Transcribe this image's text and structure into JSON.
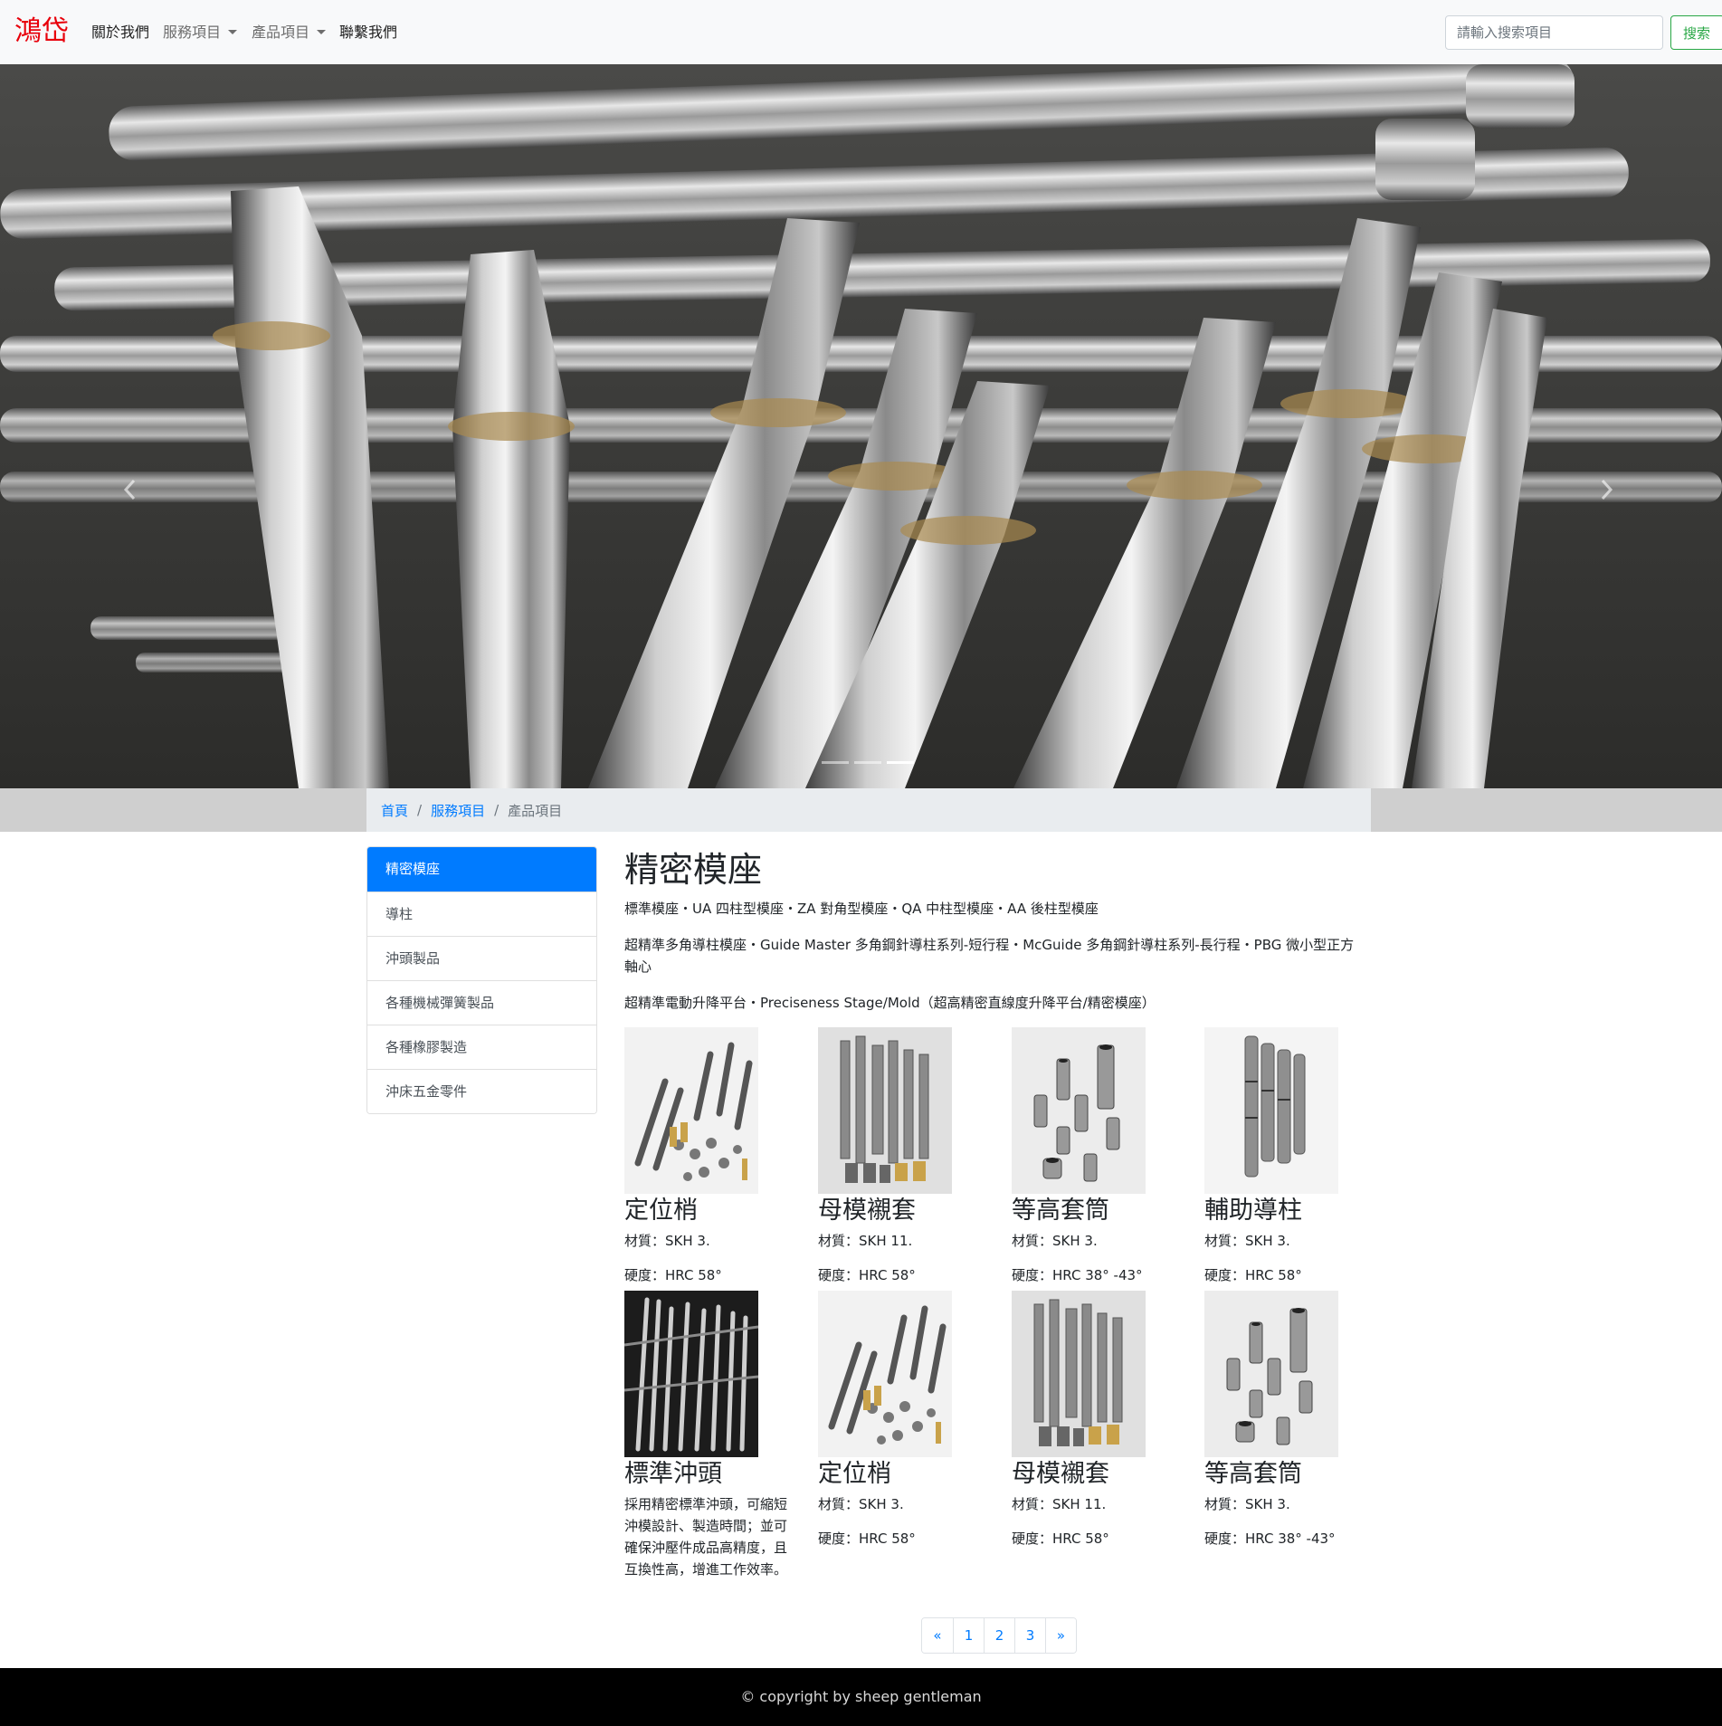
{
  "navbar": {
    "brand": "鴻岱",
    "links": [
      {
        "label": "關於我們"
      },
      {
        "label": "服務項目"
      },
      {
        "label": "產品項目"
      },
      {
        "label": "聯繫我們"
      }
    ],
    "search": {
      "placeholder": "請輸入搜索項目",
      "button_label": "搜索"
    }
  },
  "carousel": {
    "slide_count": 3,
    "active_index": 2,
    "icons": [
      "chevron-left-icon",
      "chevron-right-icon"
    ]
  },
  "breadcrumb": {
    "items": [
      "首頁",
      "服務項目",
      "產品項目"
    ],
    "separator": "/"
  },
  "sidebar": {
    "items": [
      {
        "label": "精密模座",
        "active": true
      },
      {
        "label": "導柱"
      },
      {
        "label": "沖頭製品"
      },
      {
        "label": "各種機械彈簧製品"
      },
      {
        "label": "各種橡膠製造"
      },
      {
        "label": "沖床五金零件"
      }
    ]
  },
  "main": {
    "title": "精密模座",
    "paragraphs": [
      "標準模座・UA 四柱型模座・ZA 對角型模座・QA 中柱型模座・AA 後柱型模座",
      "超精準多角導柱模座・Guide Master 多角鋼針導柱系列-短行程・McGuide 多角鋼針導柱系列-長行程・PBG 微小型正方軸心",
      "超精準電動升降平台・Preciseness Stage/Mold（超高精密直線度升降平台/精密模座）"
    ],
    "products": [
      {
        "name": "定位梢",
        "material": "材質：SKH 3.",
        "hardness": "硬度：HRC 58°"
      },
      {
        "name": "母模襯套",
        "material": "材質：SKH 11.",
        "hardness": "硬度：HRC 58°"
      },
      {
        "name": "等高套筒",
        "material": "材質：SKH 3.",
        "hardness": "硬度：HRC 38° -43°"
      },
      {
        "name": "輔助導柱",
        "material": "材質：SKH 3.",
        "hardness": "硬度：HRC 58°"
      },
      {
        "name": "標準沖頭",
        "description": "採用精密標準沖頭，可縮短沖模設計、製造時間；並可確保沖壓件成品高精度，且互換性高，增進工作效率。"
      },
      {
        "name": "定位梢",
        "material": "材質：SKH 3.",
        "hardness": "硬度：HRC 58°"
      },
      {
        "name": "母模襯套",
        "material": "材質：SKH 11.",
        "hardness": "硬度：HRC 58°"
      },
      {
        "name": "等高套筒",
        "material": "材質：SKH 3.",
        "hardness": "硬度：HRC 38° -43°"
      }
    ]
  },
  "pagination": {
    "prev": "«",
    "pages": [
      "1",
      "2",
      "3"
    ],
    "next": "»"
  },
  "footer": {
    "text": "© copyright by sheep gentleman"
  },
  "colors": {
    "brand": "#e8000b",
    "link": "#007bff",
    "success": "#28a745",
    "footer_bg": "#000000"
  }
}
